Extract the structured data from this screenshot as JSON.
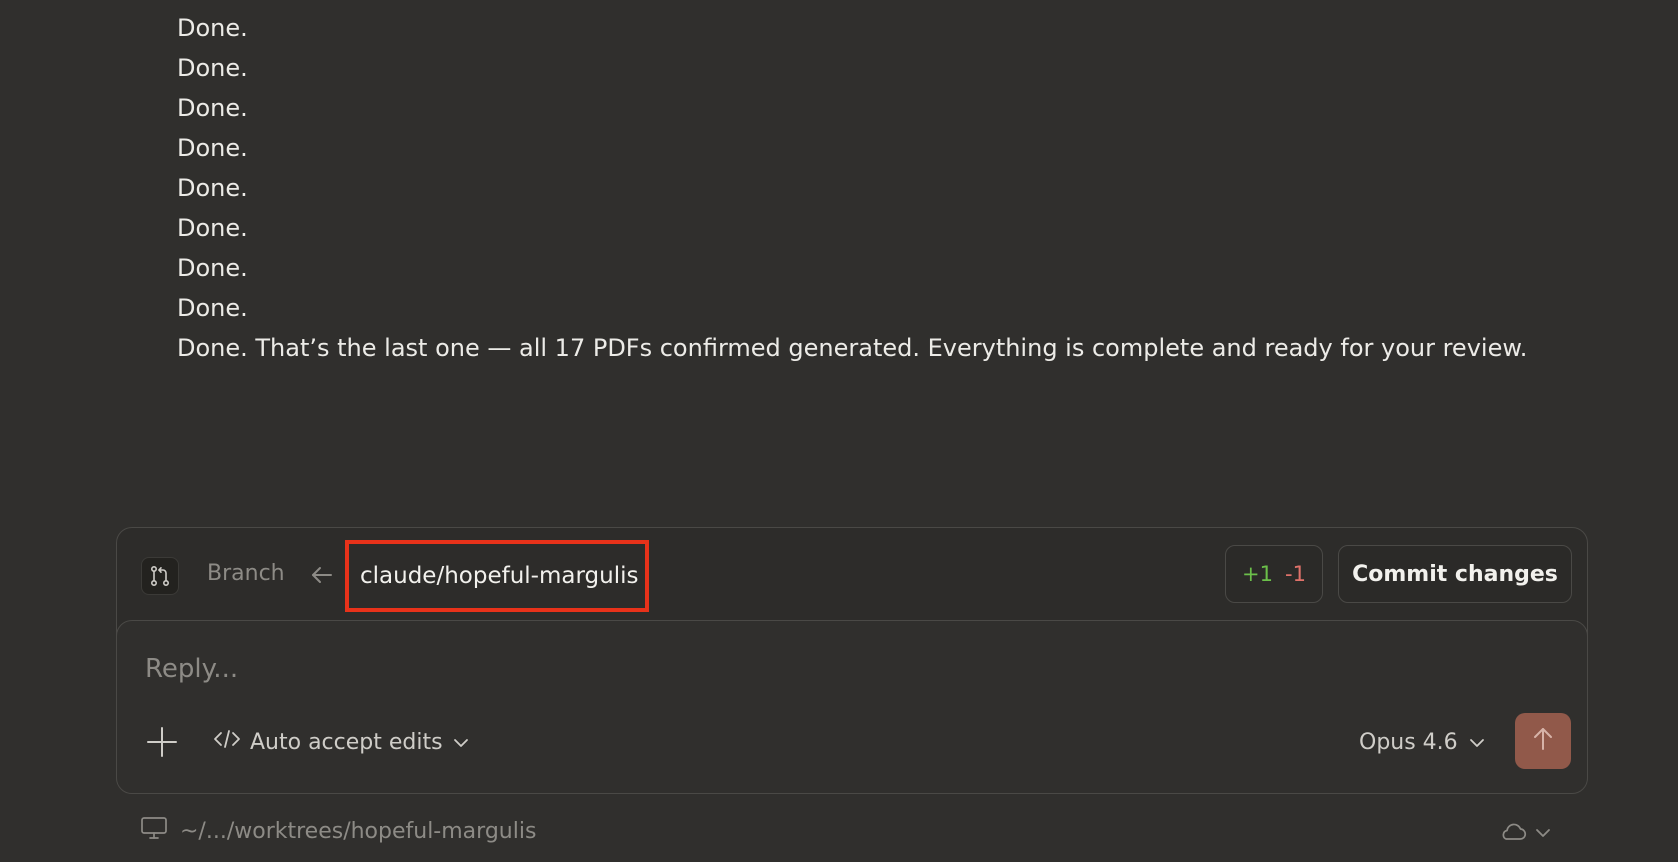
{
  "messages": {
    "lines": [
      "Done.",
      "Done.",
      "Done.",
      "Done.",
      "Done.",
      "Done.",
      "Done.",
      "Done.",
      "Done. That’s the last one — all 17 PDFs confirmed generated. Everything is complete and ready for your review."
    ]
  },
  "branch_bar": {
    "icon": "git-branch-icon",
    "label": "Branch",
    "arrow_icon": "arrow-left-icon",
    "branch_name": "claude/hopeful-margulis",
    "diff_added": "+1",
    "diff_removed": "-1",
    "commit_label": "Commit changes",
    "colors": {
      "added": "#6bbf4a",
      "removed": "#e0726a",
      "highlight": "#e8321a"
    }
  },
  "composer": {
    "placeholder": "Reply...",
    "value": "",
    "plus_icon": "plus-icon",
    "mode_icon": "code-icon",
    "mode_label": "Auto accept edits",
    "model_label": "Opus 4.6",
    "send_icon": "arrow-up-icon",
    "send_color": "#91594a"
  },
  "footer": {
    "monitor_icon": "monitor-icon",
    "path": "~/.../worktrees/hopeful-margulis",
    "cloud_icon": "cloud-icon"
  }
}
